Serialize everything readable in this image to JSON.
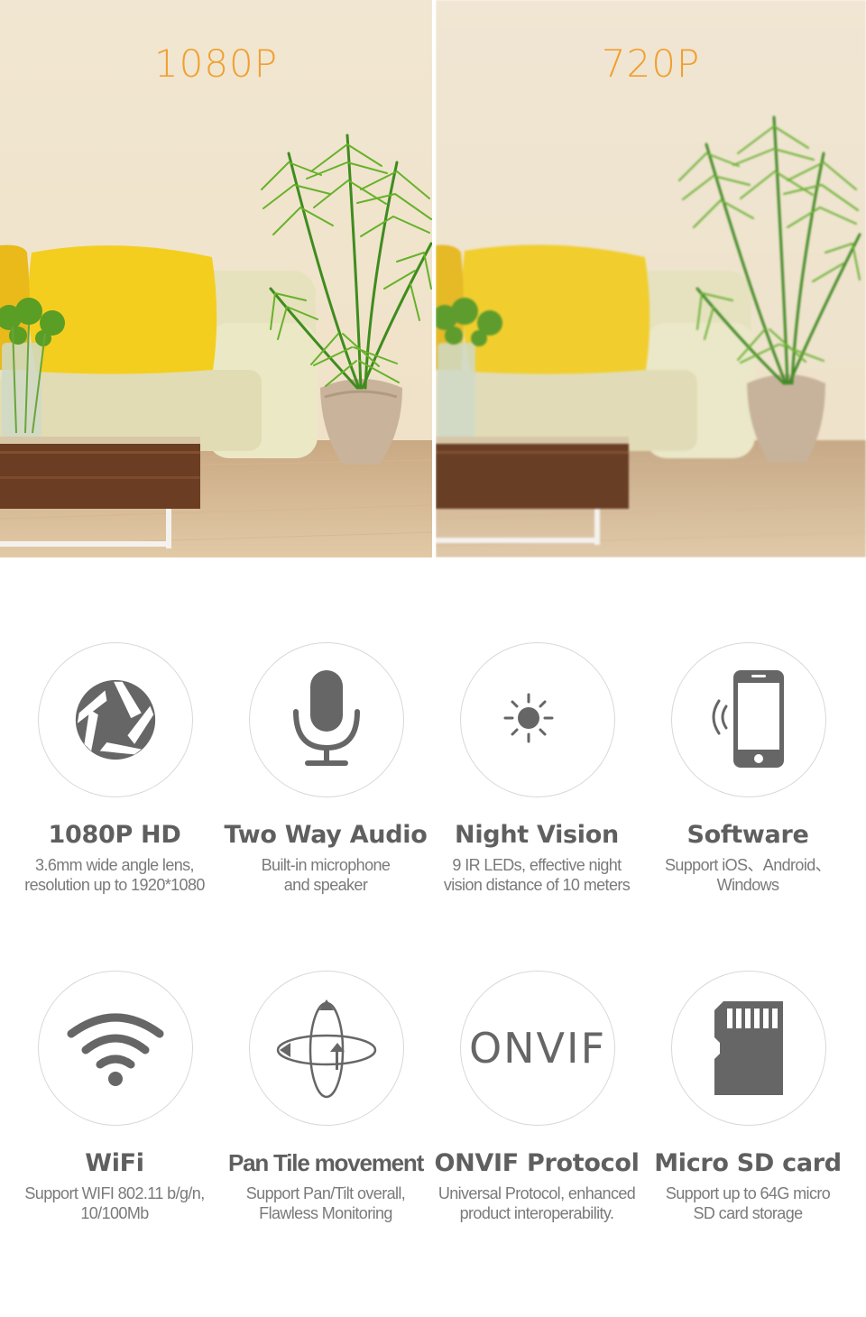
{
  "comparison": {
    "left_label": "1080P",
    "right_label": "720P",
    "label_color": "#f0a030"
  },
  "features": [
    {
      "icon": "aperture-icon",
      "title": "1080P HD",
      "desc_lines": [
        "3.6mm wide angle lens,",
        "resolution up to 1920*1080"
      ]
    },
    {
      "icon": "microphone-icon",
      "title": "Two Way Audio",
      "desc_lines": [
        "Built-in microphone",
        "and speaker"
      ]
    },
    {
      "icon": "sun-moon-icon",
      "title": "Night Vision",
      "desc_lines": [
        "9 IR LEDs, effective night",
        "vision distance of 10 meters"
      ]
    },
    {
      "icon": "smartphone-signal-icon",
      "title": "Software",
      "desc_lines": [
        "Support iOS、Android、",
        "Windows"
      ]
    },
    {
      "icon": "wifi-icon",
      "title": "WiFi",
      "desc_lines": [
        "Support WIFI 802.11 b/g/n,",
        "10/100Mb"
      ]
    },
    {
      "icon": "pan-tilt-icon",
      "title": "Pan Tile movement",
      "desc_lines": [
        "Support Pan/Tilt overall,",
        "Flawless Monitoring"
      ]
    },
    {
      "icon": "onvif-logo-icon",
      "logo_text": "ONVIF",
      "title": "ONVIF Protocol",
      "desc_lines": [
        "Universal Protocol, enhanced",
        "product interoperability."
      ]
    },
    {
      "icon": "micro-sd-card-icon",
      "title": "Micro SD card",
      "desc_lines": [
        "Support up to 64G micro",
        "SD card storage"
      ]
    }
  ],
  "colors": {
    "icon_gray": "#666666",
    "title_gray": "#5f5f5f",
    "desc_gray": "#7a7a7a",
    "circle_border": "#d8d8d8"
  }
}
